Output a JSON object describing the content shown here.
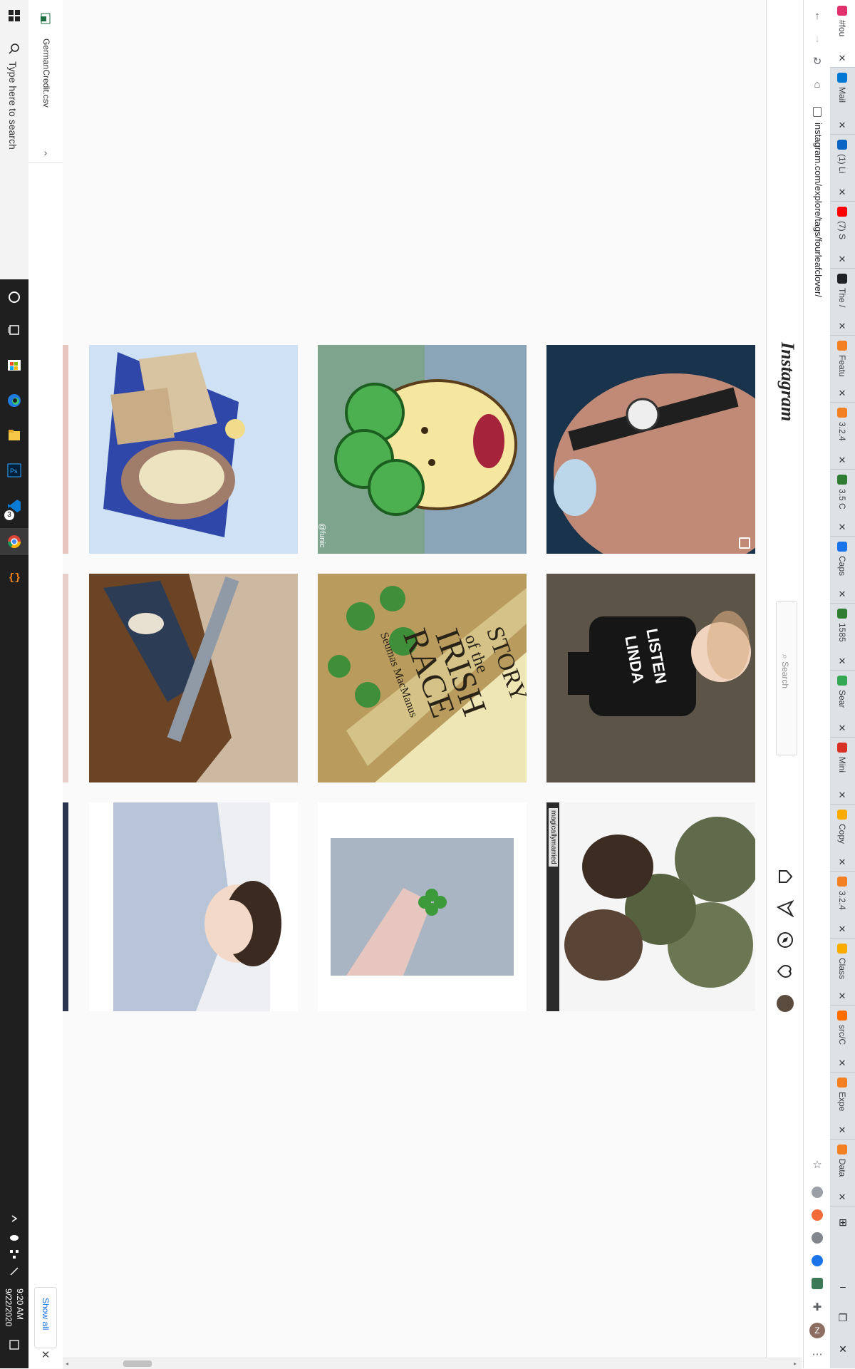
{
  "taskbar": {
    "search_placeholder": "Type here to search",
    "clock_time": "9:20 AM",
    "clock_date": "9/22/2020",
    "icons": [
      "windows-start-icon",
      "search-icon",
      "cortana-icon",
      "task-view-icon",
      "store-icon",
      "edge-icon",
      "file-explorer-icon",
      "photoshop-icon",
      "vscode-icon",
      "chrome-icon",
      "brackets-icon"
    ],
    "vscode_badge": "3"
  },
  "downloads": {
    "file_name": "GermanCredit.csv",
    "show_all": "Show all"
  },
  "browser": {
    "url": "instagram.com/explore/tags/fourleafclover/",
    "tabs": [
      {
        "label": "#fou",
        "color": "#e1306c"
      },
      {
        "label": "Mail",
        "color": "#0078d4"
      },
      {
        "label": "(1) Li",
        "color": "#0a66c2"
      },
      {
        "label": "(7) S",
        "color": "#ff0000"
      },
      {
        "label": "The /",
        "color": "#202124"
      },
      {
        "label": "Featu",
        "color": "#f48024"
      },
      {
        "label": "3.2.4",
        "color": "#f48024"
      },
      {
        "label": "3.5 C",
        "color": "#2e7d32"
      },
      {
        "label": "Caps",
        "color": "#1a73e8"
      },
      {
        "label": "1585",
        "color": "#2e7d32"
      },
      {
        "label": "Sear",
        "color": "#34a853"
      },
      {
        "label": "Mini",
        "color": "#d93025"
      },
      {
        "label": "Copy",
        "color": "#f9ab00"
      },
      {
        "label": "3.2.4",
        "color": "#f48024"
      },
      {
        "label": "Class",
        "color": "#f9ab00"
      },
      {
        "label": "src/C",
        "color": "#ff6d00"
      },
      {
        "label": "Expe",
        "color": "#f48024"
      },
      {
        "label": "Data",
        "color": "#f48024"
      }
    ]
  },
  "instagram": {
    "logo": "Instagram",
    "search_placeholder": "Search",
    "grid": [
      {
        "name": "food-bread-post",
        "bg": "#2f47a8"
      },
      {
        "name": "clover-character-post",
        "bg": "#8fb3a0"
      },
      {
        "name": "bracelet-post",
        "bg": "#b07a68"
      },
      {
        "name": "rifle-engraving-post",
        "bg": "#7a5b3e"
      },
      {
        "name": "irish-race-book-post",
        "bg": "#c9b46a"
      },
      {
        "name": "toddler-post",
        "bg": "#4a4438"
      },
      {
        "name": "portrait-post",
        "bg": "#e9e9ee"
      },
      {
        "name": "hand-clover-post",
        "bg": "#ffffff"
      },
      {
        "name": "couple-clover-post",
        "bg": "#5f6b4a"
      }
    ],
    "overlay_watermark": "@funic",
    "reposter": "magicallymarried",
    "book_title_lines": [
      "STORY",
      "of the",
      "IRISH",
      "RACE"
    ],
    "book_author": "Seumas MacManus"
  }
}
